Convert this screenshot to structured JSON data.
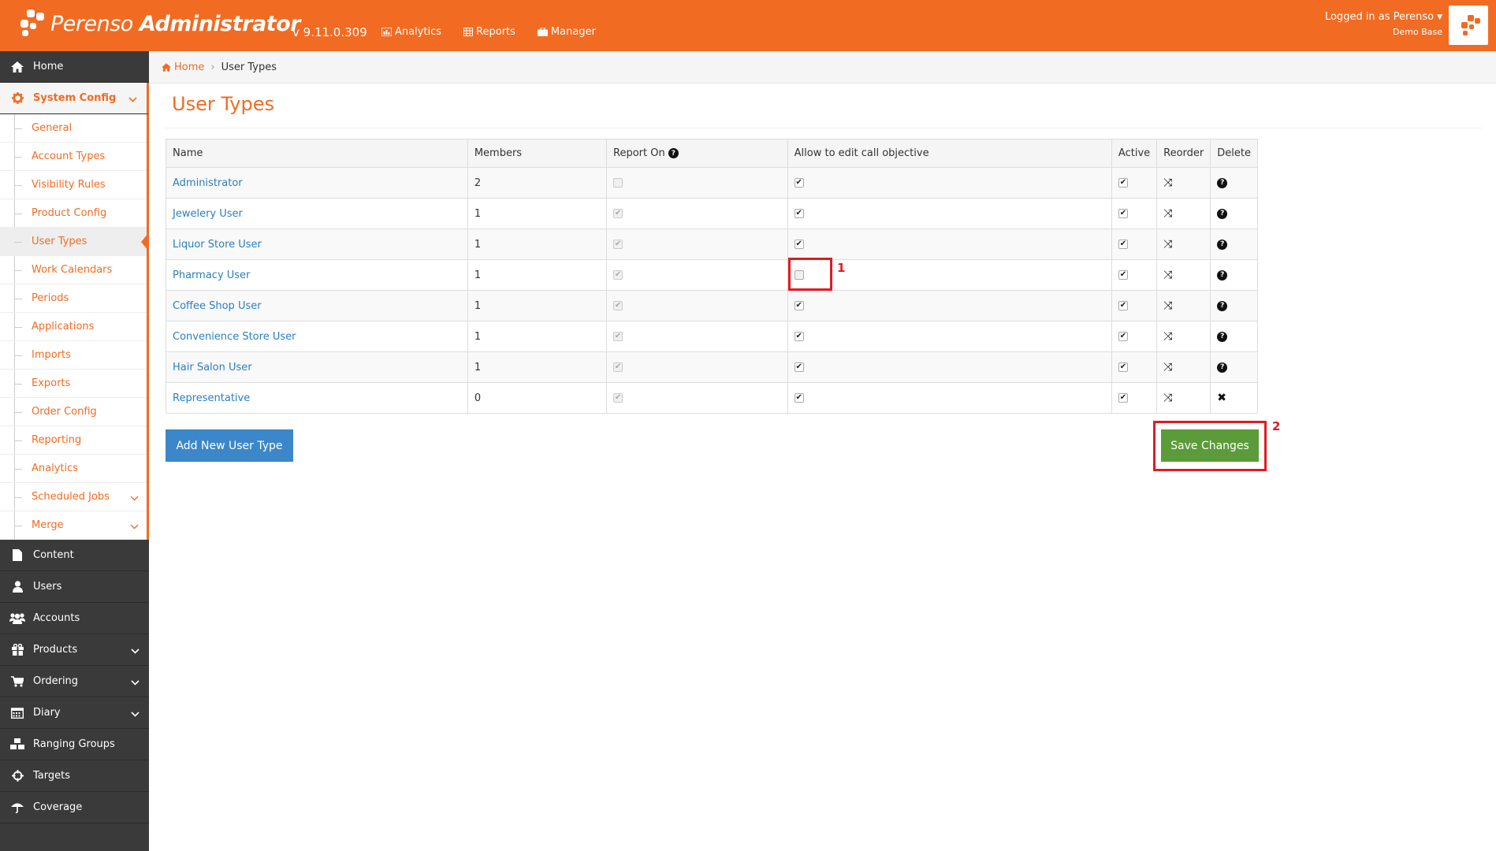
{
  "header": {
    "app_title_light": "Perenso",
    "app_title_bold": "Administrator",
    "version": "v 9.11.0.309",
    "nav": [
      {
        "label": "Analytics",
        "icon": "bar-chart-icon"
      },
      {
        "label": "Reports",
        "icon": "table-icon"
      },
      {
        "label": "Manager",
        "icon": "briefcase-icon"
      }
    ],
    "user_label": "Logged in as Perenso",
    "user_base": "Demo Base"
  },
  "sidebar": {
    "items_top": [
      {
        "label": "Home",
        "icon": "home-icon"
      },
      {
        "label": "System Config",
        "icon": "gear-icon"
      }
    ],
    "system_config_items": [
      {
        "label": "General"
      },
      {
        "label": "Account Types"
      },
      {
        "label": "Visibility Rules"
      },
      {
        "label": "Product Config"
      },
      {
        "label": "User Types"
      },
      {
        "label": "Work Calendars"
      },
      {
        "label": "Periods"
      },
      {
        "label": "Applications"
      },
      {
        "label": "Imports"
      },
      {
        "label": "Exports"
      },
      {
        "label": "Order Config"
      },
      {
        "label": "Reporting"
      },
      {
        "label": "Analytics"
      },
      {
        "label": "Scheduled Jobs"
      },
      {
        "label": "Merge"
      }
    ],
    "items_bottom": [
      {
        "label": "Content"
      },
      {
        "label": "Users"
      },
      {
        "label": "Accounts"
      },
      {
        "label": "Products"
      },
      {
        "label": "Ordering"
      },
      {
        "label": "Diary"
      },
      {
        "label": "Ranging Groups"
      },
      {
        "label": "Targets"
      },
      {
        "label": "Coverage"
      }
    ]
  },
  "breadcrumb": {
    "home": "Home",
    "current": "User Types"
  },
  "page": {
    "title": "User Types"
  },
  "table": {
    "headers": {
      "name": "Name",
      "members": "Members",
      "report_on": "Report On",
      "allow_edit": "Allow to edit call objective",
      "active": "Active",
      "reorder": "Reorder",
      "delete": "Delete"
    },
    "rows": [
      {
        "name": "Administrator",
        "members": "2"
      },
      {
        "name": "Jewelery User",
        "members": "1"
      },
      {
        "name": "Liquor Store User",
        "members": "1"
      },
      {
        "name": "Pharmacy User",
        "members": "1"
      },
      {
        "name": "Coffee Shop User",
        "members": "1"
      },
      {
        "name": "Convenience Store User",
        "members": "1"
      },
      {
        "name": "Hair Salon User",
        "members": "1"
      },
      {
        "name": "Representative",
        "members": "0"
      }
    ]
  },
  "buttons": {
    "add": "Add New User Type",
    "save": "Save Changes"
  },
  "annotations": {
    "one": "1",
    "two": "2"
  },
  "colors": {
    "brand": "#f26b22",
    "primary_button": "#3b87c9",
    "save_button": "#5c9b3a",
    "highlight": "#e01b24"
  }
}
